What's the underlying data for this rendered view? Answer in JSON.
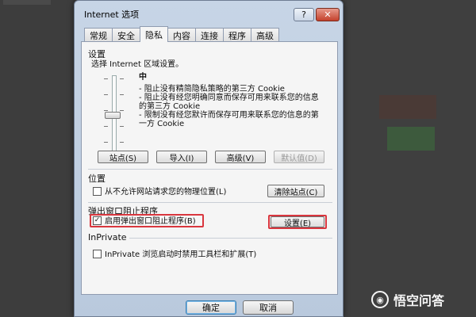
{
  "window": {
    "title": "Internet 选项",
    "help_label": "?",
    "close_label": "✕"
  },
  "tabs": [
    {
      "label": "常规"
    },
    {
      "label": "安全"
    },
    {
      "label": "隐私"
    },
    {
      "label": "内容"
    },
    {
      "label": "连接"
    },
    {
      "label": "程序"
    },
    {
      "label": "高级"
    }
  ],
  "active_tab": "隐私",
  "settings": {
    "heading": "设置",
    "subtitle": "选择 Internet 区域设置。",
    "level": "中",
    "lines": [
      "- 阻止没有精简隐私策略的第三方 Cookie",
      "- 阻止没有经您明确同意而保存可用来联系您的信息",
      "的第三方 Cookie",
      "- 限制没有经您默许而保存可用来联系您的信息的第",
      "一方 Cookie"
    ],
    "buttons": {
      "sites": "站点(S)",
      "import": "导入(I)",
      "advanced": "高级(V)",
      "default": "默认值(D)"
    }
  },
  "location": {
    "heading": "位置",
    "checkbox_label": "从不允许网站请求您的物理位置(L)",
    "checked": false,
    "clear_button": "清除站点(C)"
  },
  "popup": {
    "heading": "弹出窗口阻止程序",
    "checkbox_label": "启用弹出窗口阻止程序(B)",
    "checked": true,
    "settings_button": "设置(E)"
  },
  "inprivate": {
    "heading": "InPrivate",
    "checkbox_label": "InPrivate 浏览启动时禁用工具栏和扩展(T)",
    "checked": false
  },
  "footer": {
    "ok": "确定",
    "cancel": "取消"
  },
  "watermark": {
    "text": "悟空问答",
    "icon": "wukong-logo-icon"
  },
  "colors": {
    "highlight": "#d9363e",
    "titlebar": "#c7d5e6",
    "close": "#c4412c"
  }
}
